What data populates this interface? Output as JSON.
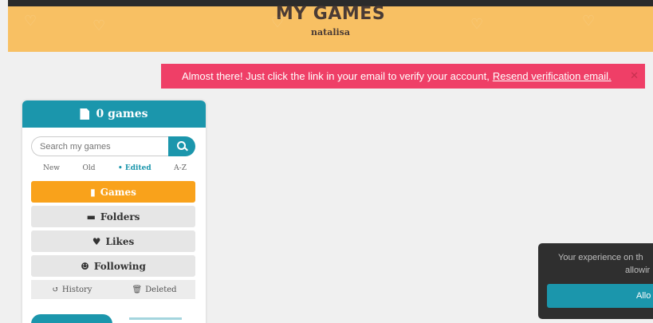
{
  "header": {
    "title": "MY GAMES",
    "username": "natalisa"
  },
  "alert": {
    "message": "Almost there! Just click the link in your email to verify your account,",
    "link": "Resend verification email.",
    "close_icon": "close-icon"
  },
  "sidebar": {
    "count_label": "0 games",
    "search_placeholder": "Search my games",
    "sorts": [
      {
        "label": "New",
        "active": false
      },
      {
        "label": "Old",
        "active": false
      },
      {
        "label": "• Edited",
        "active": true
      },
      {
        "label": "A-Z",
        "active": false
      }
    ],
    "nav": {
      "games": "Games",
      "folders": "Folders",
      "likes": "Likes",
      "following": "Following"
    },
    "mini": {
      "history": "History",
      "deleted": "Deleted"
    }
  },
  "cookie": {
    "line1": "Your experience on th",
    "line2": "allowir",
    "button": "Allo"
  },
  "colors": {
    "accent": "#1b96ac",
    "active_nav": "#f9a21b",
    "alert": "#ef3f67",
    "header": "#f8c063"
  }
}
